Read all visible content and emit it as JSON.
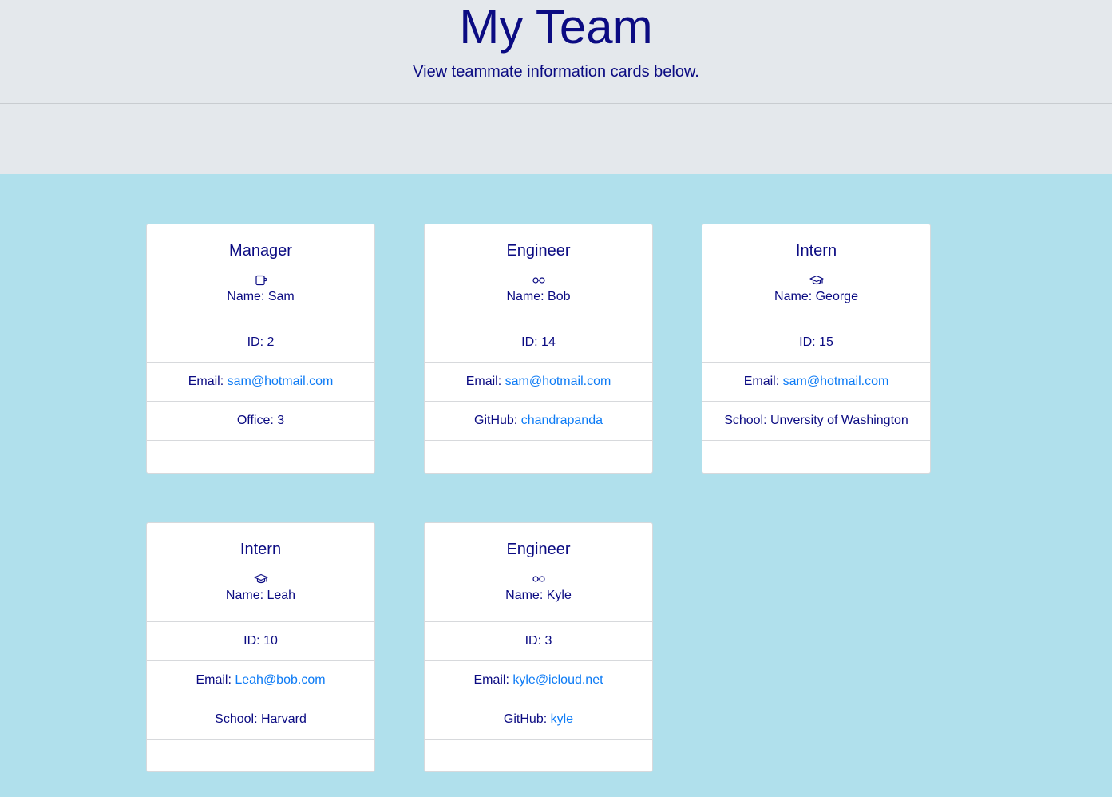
{
  "header": {
    "title": "My Team",
    "subtitle": "View teammate information cards below."
  },
  "colors": {
    "accent": "#0b0b82",
    "link": "#0d7bf5",
    "hero_bg": "#e4e8ec",
    "page_bg": "#b0e0ec"
  },
  "cards": [
    {
      "role": "Manager",
      "icon": "mug-icon",
      "name": "Name: Sam",
      "id": "ID: 2",
      "email_label": "Email: ",
      "email": "sam@hotmail.com",
      "extra_label": "Office: 3",
      "extra_link": ""
    },
    {
      "role": "Engineer",
      "icon": "glasses-icon",
      "name": "Name: Bob",
      "id": "ID: 14",
      "email_label": "Email: ",
      "email": "sam@hotmail.com",
      "extra_label": "GitHub: ",
      "extra_link": "chandrapanda"
    },
    {
      "role": "Intern",
      "icon": "graduation-cap-icon",
      "name": "Name: George",
      "id": "ID: 15",
      "email_label": "Email: ",
      "email": "sam@hotmail.com",
      "extra_label": "School: Unversity of Washington",
      "extra_link": ""
    },
    {
      "role": "Intern",
      "icon": "graduation-cap-icon",
      "name": "Name: Leah",
      "id": "ID: 10",
      "email_label": "Email: ",
      "email": "Leah@bob.com",
      "extra_label": "School: Harvard",
      "extra_link": ""
    },
    {
      "role": "Engineer",
      "icon": "glasses-icon",
      "name": "Name: Kyle",
      "id": "ID: 3",
      "email_label": "Email: ",
      "email": "kyle@icloud.net",
      "extra_label": "GitHub: ",
      "extra_link": "kyle"
    }
  ]
}
